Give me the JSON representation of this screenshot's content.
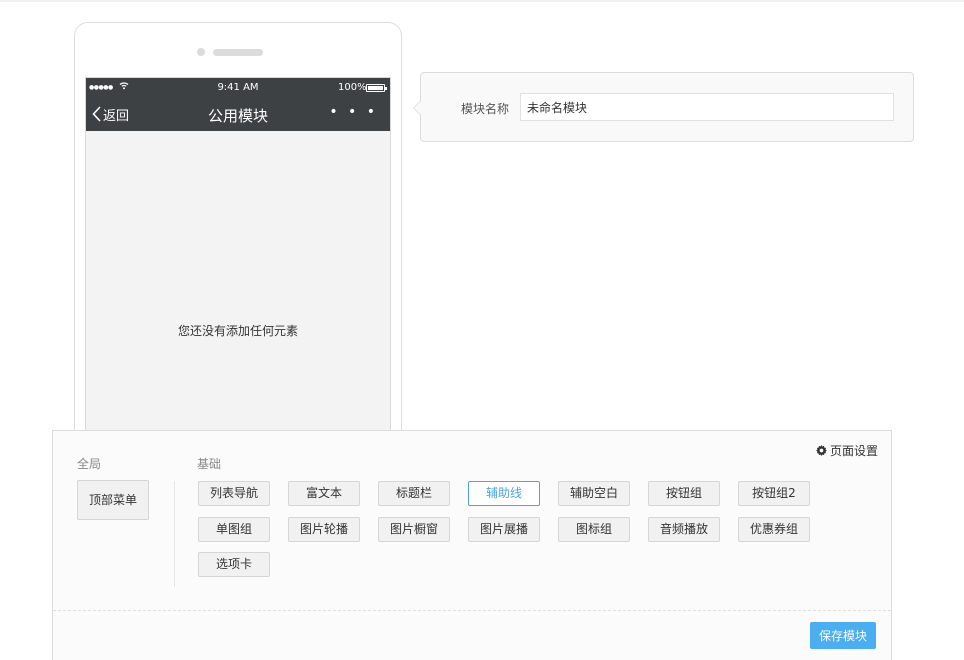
{
  "phone": {
    "status": {
      "time": "9:41 AM",
      "battery": "100%"
    },
    "nav": {
      "back_label": "返回",
      "title": "公用模块",
      "more": "• • •"
    },
    "empty_hint": "您还没有添加任何元素"
  },
  "module_name": {
    "label": "模块名称",
    "value": "未命名模块"
  },
  "components": {
    "page_settings_label": "页面设置",
    "global": {
      "title": "全局",
      "items": [
        "顶部菜单"
      ]
    },
    "basic": {
      "title": "基础",
      "items": [
        "列表导航",
        "富文本",
        "标题栏",
        "辅助线",
        "辅助空白",
        "按钮组",
        "按钮组2",
        "单图组",
        "图片轮播",
        "图片橱窗",
        "图片展播",
        "图标组",
        "音频播放",
        "优惠券组",
        "选项卡"
      ],
      "active": "辅助线"
    },
    "save_label": "保存模块"
  },
  "colors": {
    "accent": "#4ba6df",
    "save": "#4aaef0",
    "navbar": "#3e4144"
  }
}
